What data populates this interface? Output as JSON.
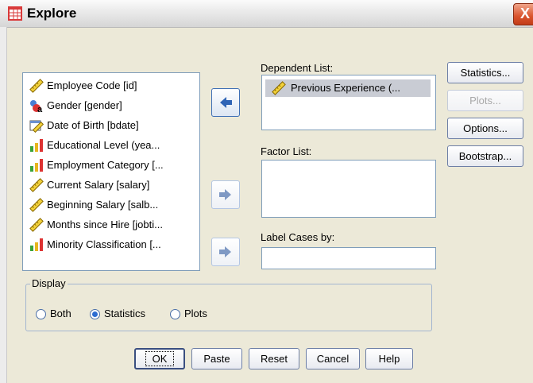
{
  "window": {
    "title": "Explore",
    "close_glyph": "X"
  },
  "variables": [
    {
      "label": "Employee Code [id]",
      "icon": "ruler-scale-icon"
    },
    {
      "label": "Gender [gender]",
      "icon": "nominal-string-icon"
    },
    {
      "label": "Date of Birth [bdate]",
      "icon": "date-scale-icon"
    },
    {
      "label": "Educational Level (yea...",
      "icon": "ordinal-bar-icon"
    },
    {
      "label": "Employment Category [...",
      "icon": "ordinal-bar-icon"
    },
    {
      "label": "Current Salary [salary]",
      "icon": "ruler-scale-icon"
    },
    {
      "label": "Beginning Salary [salb...",
      "icon": "ruler-scale-icon"
    },
    {
      "label": "Months since Hire [jobti...",
      "icon": "ruler-scale-icon"
    },
    {
      "label": "Minority Classification [...",
      "icon": "ordinal-bar-icon"
    }
  ],
  "dependent_list": {
    "label": "Dependent List:",
    "items": [
      "Previous Experience (..."
    ]
  },
  "factor_list": {
    "label": "Factor List:"
  },
  "label_cases": {
    "label": "Label Cases by:"
  },
  "side_buttons": {
    "statistics": "Statistics...",
    "plots": "Plots...",
    "options": "Options...",
    "bootstrap": "Bootstrap..."
  },
  "display": {
    "title": "Display",
    "options": [
      "Both",
      "Statistics",
      "Plots"
    ],
    "selected": "Statistics"
  },
  "bottom_buttons": {
    "ok": "OK",
    "paste": "Paste",
    "reset": "Reset",
    "cancel": "Cancel",
    "help": "Help"
  },
  "colors": {
    "dialog_bg": "#ece9d8",
    "list_border": "#7f9db9",
    "selection_bg": "#c9ccd4",
    "accent": "#2c6cd1"
  }
}
